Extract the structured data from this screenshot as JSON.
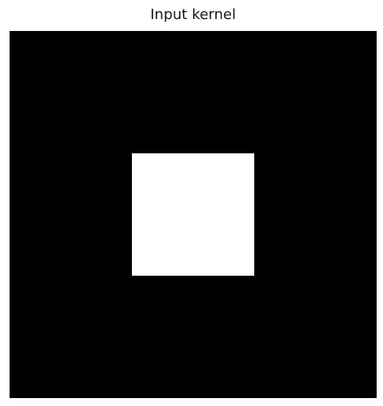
{
  "chart_data": {
    "type": "heatmap",
    "title": "Input kernel",
    "xlabel": "",
    "ylabel": "",
    "grid": false,
    "colormap": "gray",
    "color_low": "#000000",
    "color_high": "#ffffff",
    "rows": 3,
    "cols": 3,
    "values": [
      [
        0,
        0,
        0
      ],
      [
        0,
        1,
        0
      ],
      [
        0,
        0,
        0
      ]
    ]
  }
}
